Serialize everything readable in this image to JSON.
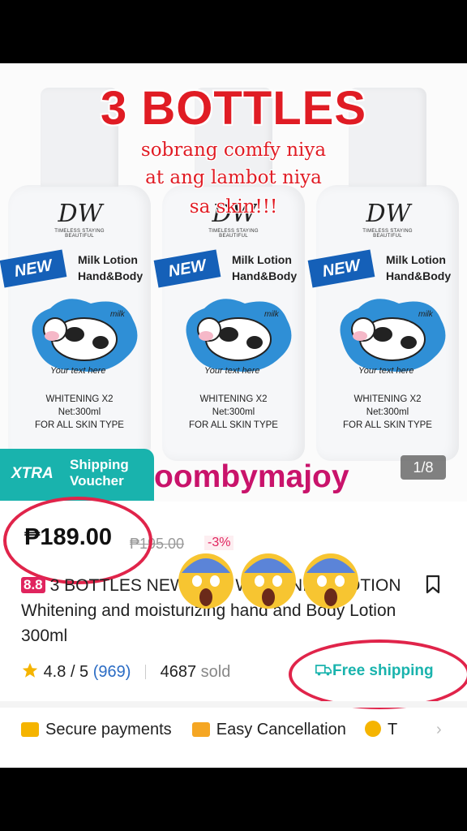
{
  "hero": {
    "overlay_title": "3 BOTTLES",
    "overlay_line1": "sobrang comfy niya",
    "overlay_line2": "at ang lambot niya",
    "overlay_line3": "sa skin!!!",
    "bottle": {
      "logo": "DW",
      "tagline": "TIMELESS STAYING BEAUTIFUL",
      "new_label": "NEW",
      "name_line1": "Milk Lotion",
      "name_line2": "Hand&Body",
      "your_text": "Your text here",
      "milk_word": "milk",
      "whitening": "WHITENING X2",
      "net": "Net:300ml",
      "skin": "FOR ALL SKIN TYPE"
    },
    "xtra_label": "XTRA",
    "xtra_line1": "Shipping",
    "xtra_line2": "Voucher",
    "shop_watermark": "oombymajoy",
    "image_counter": "1/8"
  },
  "product": {
    "price": "₱189.00",
    "original_price": "₱195.00",
    "discount": "-3%",
    "badge": "8.8",
    "title": "3 BOTTLES NEW MILK WHITENING LOTION Whitening and moisturizing hand and Body Lotion 300ml",
    "rating": "4.8",
    "rating_max": "/ 5",
    "review_count": "(969)",
    "sold_count": "4687",
    "sold_label": "sold",
    "shipping": "Free shipping",
    "emoji_overlay": "😱😱😱"
  },
  "assurance": {
    "secure": "Secure payments",
    "cancel": "Easy Cancellation",
    "third": "T"
  },
  "colors": {
    "accent": "#19b3ad",
    "price_red": "#e0245e",
    "title_red": "#e01c24"
  }
}
